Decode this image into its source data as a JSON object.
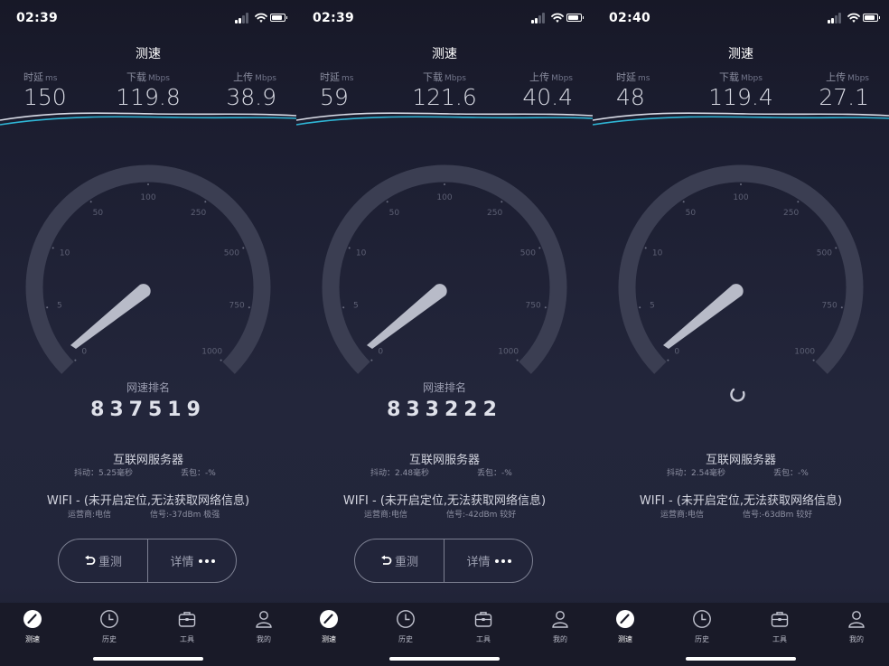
{
  "screens": [
    {
      "time": "02:39",
      "title": "测速",
      "metrics": {
        "latency": {
          "label": "时延",
          "unit": "ms",
          "value": "150"
        },
        "download": {
          "label": "下载",
          "unit": "Mbps",
          "value": "119.8"
        },
        "upload": {
          "label": "上传",
          "unit": "Mbps",
          "value": "38.9"
        }
      },
      "gauge_ticks": [
        "0",
        "5",
        "10",
        "50",
        "100",
        "250",
        "500",
        "750",
        "1000"
      ],
      "rank_label": "网速排名",
      "rank_value": "837519",
      "server": {
        "name": "互联网服务器",
        "jitter": "抖动：5.25毫秒",
        "loss": "丢包：-%"
      },
      "network": {
        "wifi": "WIFI - (未开启定位,无法获取网络信息)",
        "carrier": "运营商:电信",
        "signal": "信号:-37dBm 极强"
      },
      "buttons": {
        "retest": "重测",
        "detail": "详情"
      },
      "tabs": [
        "测速",
        "历史",
        "工具",
        "我的"
      ]
    },
    {
      "time": "02:39",
      "title": "测速",
      "metrics": {
        "latency": {
          "label": "时延",
          "unit": "ms",
          "value": "59"
        },
        "download": {
          "label": "下载",
          "unit": "Mbps",
          "value": "121.6"
        },
        "upload": {
          "label": "上传",
          "unit": "Mbps",
          "value": "40.4"
        }
      },
      "gauge_ticks": [
        "0",
        "5",
        "10",
        "50",
        "100",
        "250",
        "500",
        "750",
        "1000"
      ],
      "rank_label": "网速排名",
      "rank_value": "833222",
      "server": {
        "name": "互联网服务器",
        "jitter": "抖动：2.48毫秒",
        "loss": "丢包：-%"
      },
      "network": {
        "wifi": "WIFI - (未开启定位,无法获取网络信息)",
        "carrier": "运营商:电信",
        "signal": "信号:-42dBm 较好"
      },
      "buttons": {
        "retest": "重测",
        "detail": "详情"
      },
      "tabs": [
        "测速",
        "历史",
        "工具",
        "我的"
      ]
    },
    {
      "time": "02:40",
      "title": "测速",
      "metrics": {
        "latency": {
          "label": "时延",
          "unit": "ms",
          "value": "48"
        },
        "download": {
          "label": "下载",
          "unit": "Mbps",
          "value": "119.4"
        },
        "upload": {
          "label": "上传",
          "unit": "Mbps",
          "value": "27.1"
        }
      },
      "gauge_ticks": [
        "0",
        "5",
        "10",
        "50",
        "100",
        "250",
        "500",
        "750",
        "1000"
      ],
      "rank_label": "",
      "rank_value": "",
      "loading": true,
      "server": {
        "name": "互联网服务器",
        "jitter": "抖动：2.54毫秒",
        "loss": "丢包：-%"
      },
      "network": {
        "wifi": "WIFI - (未开启定位,无法获取网络信息)",
        "carrier": "运营商:电信",
        "signal": "信号:-63dBm 较好"
      },
      "buttons": null,
      "tabs": [
        "测速",
        "历史",
        "工具",
        "我的"
      ]
    }
  ],
  "icons": {
    "status": [
      "signal-icon",
      "wifi-icon",
      "battery-icon"
    ],
    "tabs": [
      "speedometer-icon",
      "clock-icon",
      "toolbox-icon",
      "person-icon"
    ],
    "retest": "undo-arrow-icon",
    "detail": "more-dots-icon"
  },
  "colors": {
    "background": "#22253a",
    "wave_light": "#d8dbe6",
    "wave_accent": "#2fb6d6",
    "gauge_track": "#3b3e52",
    "needle": "#c9ccd8"
  }
}
